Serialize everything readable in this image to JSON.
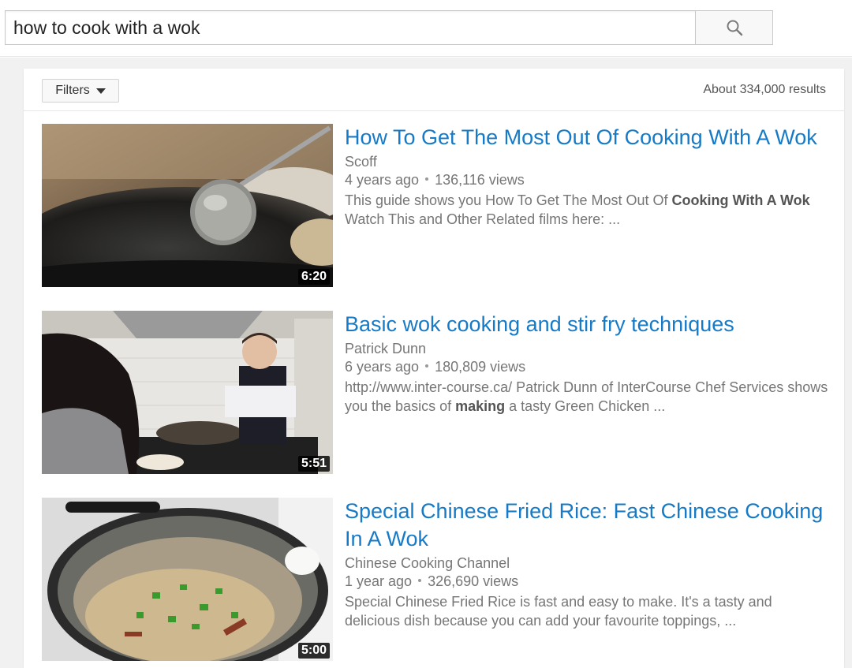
{
  "search": {
    "query": "how to cook with a wok",
    "button_icon": "search-icon"
  },
  "filters": {
    "label": "Filters",
    "result_count": "About 334,000 results"
  },
  "results": [
    {
      "title": "How To Get The Most Out Of Cooking With A Wok",
      "channel": "Scoff",
      "age": "4 years ago",
      "views": "136,116 views",
      "desc_1": "This guide shows you How To Get The Most Out Of ",
      "desc_bold": "Cooking With A Wok",
      "desc_2": " Watch This and Other Related films here: ...",
      "duration": "6:20"
    },
    {
      "title": "Basic wok cooking and stir fry techniques",
      "channel": "Patrick Dunn",
      "age": "6 years ago",
      "views": "180,809 views",
      "desc_1": "http://www.inter-course.ca/ Patrick Dunn of InterCourse Chef Services shows you the basics of ",
      "desc_bold": "making",
      "desc_2": " a tasty Green Chicken ...",
      "duration": "5:51"
    },
    {
      "title": "Special Chinese Fried Rice: Fast Chinese Cooking In A Wok",
      "channel": "Chinese Cooking Channel",
      "age": "1 year ago",
      "views": "326,690 views",
      "desc_1": "Special Chinese Fried Rice is fast and easy to make. It's a tasty and delicious dish because you can add your favourite toppings, ...",
      "desc_bold": "",
      "desc_2": "",
      "duration": "5:00"
    }
  ],
  "colors": {
    "link": "#167ac6",
    "meta": "#767676",
    "background": "#f1f1f1"
  }
}
